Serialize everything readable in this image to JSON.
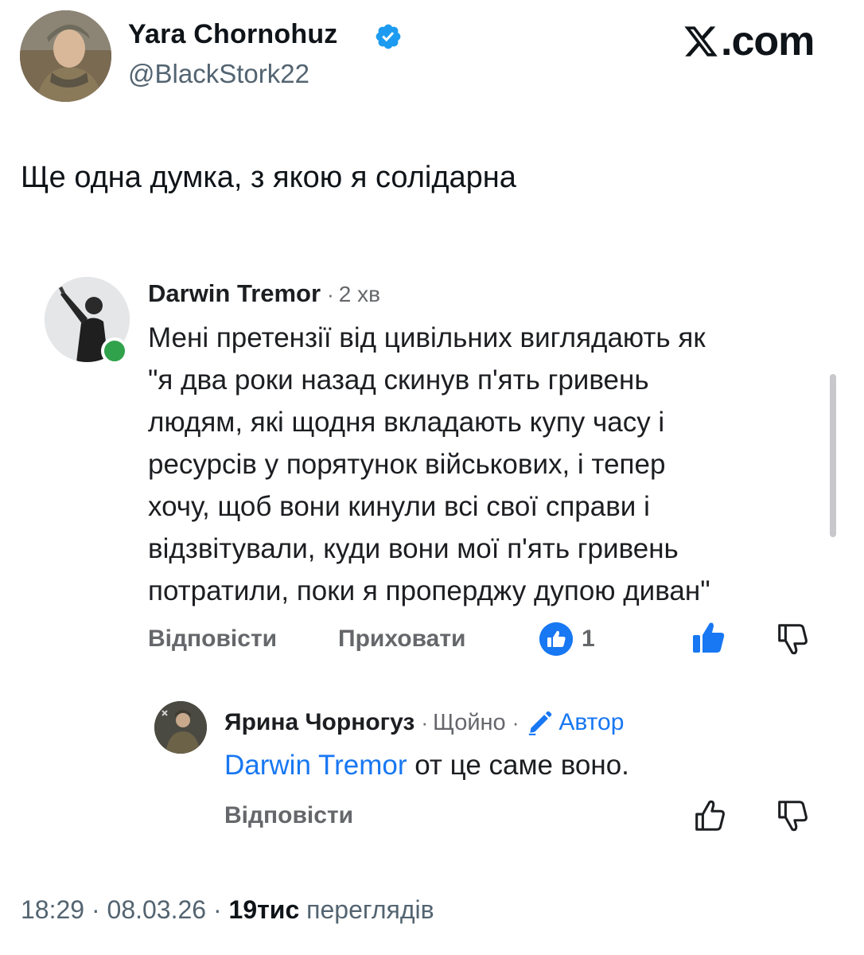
{
  "header": {
    "author_name": "Yara Chornohuz",
    "author_handle": "@BlackStork22",
    "verified": true,
    "site_logo_text": ".com"
  },
  "tweet": {
    "text": "Ще одна думка, з якою я солідарна"
  },
  "comment": {
    "author": "Darwin Tremor",
    "separator": "·",
    "time": "2 хв",
    "online": true,
    "lines": [
      "Мені претензії від цивільних виглядають як",
      "\"я два роки назад скинув п'ять гривень",
      "людям, які щодня вкладають купу часу і",
      "ресурсів у порятунок військових, і тепер",
      "хочу, щоб вони кинули всі свої справи і",
      "відзвітували, куди вони мої п'ять гривень",
      "потратили, поки я проперджу дупою диван\""
    ],
    "actions": {
      "reply": "Відповісти",
      "hide": "Приховати",
      "reaction_count": "1"
    }
  },
  "reply": {
    "author": "Ярина Чорногуз",
    "separator": "·",
    "time": "Щойно",
    "badge": "Автор",
    "mention": "Darwin Tremor",
    "text": " от це саме воно.",
    "actions": {
      "reply": "Відповісти"
    }
  },
  "footer": {
    "time": "18:29",
    "sep1": "·",
    "date": "08.03.26",
    "sep2": "·",
    "views_count": "19тис",
    "views_label": "переглядів"
  },
  "colors": {
    "facebook_blue": "#1877f2",
    "x_blue_check": "#1d9bf0",
    "online_green": "#31a24c",
    "secondary_text": "#65676b"
  },
  "icons": {
    "verified": "verified-badge-icon",
    "x_logo": "x-logo-icon",
    "like_reaction": "like-reaction-icon",
    "like": "thumbs-up-icon",
    "dislike": "thumbs-down-icon",
    "author_badge": "pencil-icon"
  }
}
